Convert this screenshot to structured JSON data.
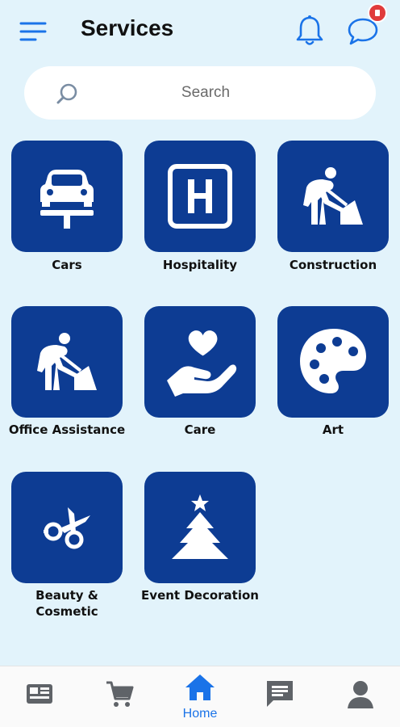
{
  "header": {
    "title": "Services",
    "menu_icon": "hamburger-menu-icon",
    "notification_icon": "bell-icon",
    "chat_icon": "chat-bubble-icon"
  },
  "search": {
    "placeholder": "Search"
  },
  "services": [
    {
      "label": "Cars",
      "icon": "car-lift-icon"
    },
    {
      "label": "Hospitality",
      "icon": "hospital-sign-icon"
    },
    {
      "label": "Construction",
      "icon": "worker-shovel-icon"
    },
    {
      "label": "Office  Assistance",
      "icon": "worker-shovel-icon"
    },
    {
      "label": "Care",
      "icon": "hand-heart-icon"
    },
    {
      "label": "Art",
      "icon": "palette-icon"
    },
    {
      "label": "Beauty &\nCosmetic",
      "icon": "scissors-icon"
    },
    {
      "label": "Event  Decoration",
      "icon": "christmas-tree-icon"
    }
  ],
  "bottom_nav": {
    "items": [
      {
        "name": "newspaper-icon"
      },
      {
        "name": "shopping-cart-icon"
      },
      {
        "name": "home-icon",
        "label": "Home",
        "active": true
      },
      {
        "name": "message-icon"
      },
      {
        "name": "profile-icon"
      }
    ]
  },
  "colors": {
    "background": "#e2f3fb",
    "tile": "#0d3c93",
    "accent": "#1a73e8",
    "badge": "#e03b3b"
  }
}
